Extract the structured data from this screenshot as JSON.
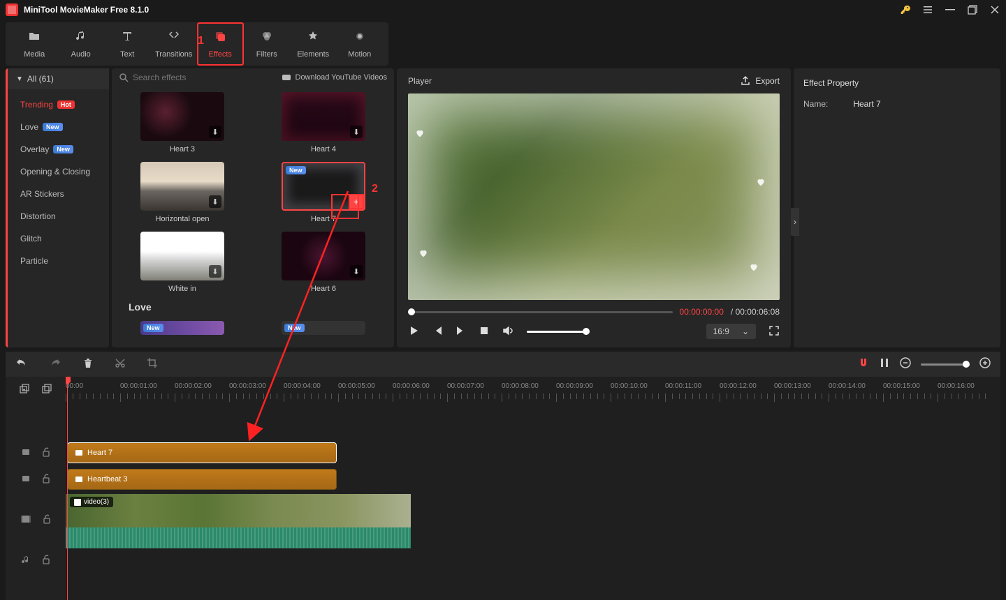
{
  "app": {
    "title": "MiniTool MovieMaker Free 8.1.0"
  },
  "tabs": {
    "media": "Media",
    "audio": "Audio",
    "text": "Text",
    "transitions": "Transitions",
    "effects": "Effects",
    "filters": "Filters",
    "elements": "Elements",
    "motion": "Motion"
  },
  "sidebar": {
    "all": "All (61)",
    "items": [
      {
        "label": "Trending",
        "badge": "Hot",
        "badge_class": "hot"
      },
      {
        "label": "Love",
        "badge": "New",
        "badge_class": "new"
      },
      {
        "label": "Overlay",
        "badge": "New",
        "badge_class": "new"
      },
      {
        "label": "Opening & Closing"
      },
      {
        "label": "AR Stickers"
      },
      {
        "label": "Distortion"
      },
      {
        "label": "Glitch"
      },
      {
        "label": "Particle"
      }
    ]
  },
  "browser": {
    "search_placeholder": "Search effects",
    "download_yt": "Download YouTube Videos",
    "section_love": "Love",
    "effects": {
      "heart3": "Heart 3",
      "heart4": "Heart 4",
      "horiz_open": "Horizontal open",
      "heart7": "Heart 7",
      "white_in": "White in",
      "heart6": "Heart 6"
    }
  },
  "player": {
    "title": "Player",
    "export": "Export",
    "time_current": "00:00:00:00",
    "time_separator": " / ",
    "time_total": "00:00:06:08",
    "aspect": "16:9"
  },
  "props": {
    "title": "Effect Property",
    "name_label": "Name:",
    "name_value": "Heart 7"
  },
  "timeline": {
    "ticks": [
      "00:00",
      "00:00:01:00",
      "00:00:02:00",
      "00:00:03:00",
      "00:00:04:00",
      "00:00:05:00",
      "00:00:06:00",
      "00:00:07:00",
      "00:00:08:00",
      "00:00:09:00",
      "00:00:10:00",
      "00:00:11:00",
      "00:00:12:00",
      "00:00:13:00",
      "00:00:14:00",
      "00:00:15:00",
      "00:00:16:00"
    ],
    "clips": {
      "heart7": "Heart 7",
      "heartbeat3": "Heartbeat 3",
      "video": "video(3)"
    }
  },
  "annotations": {
    "num1": "1",
    "num2": "2"
  },
  "badges": {
    "new": "New"
  }
}
